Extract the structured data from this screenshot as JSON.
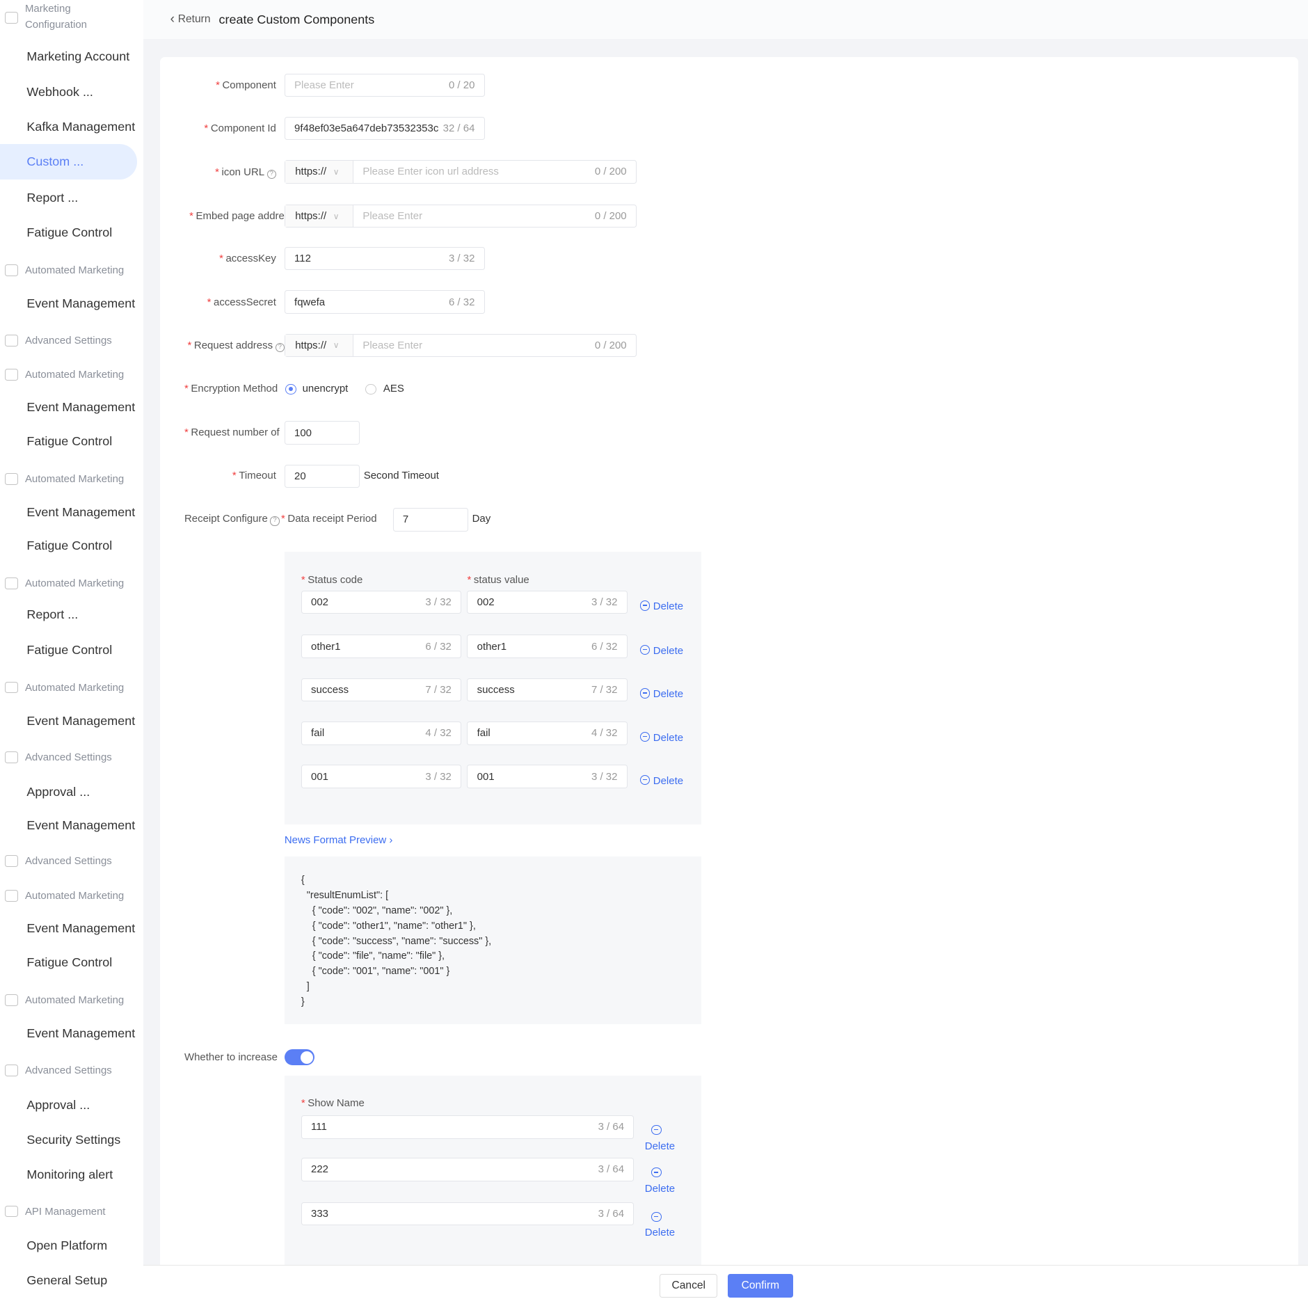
{
  "sidebar": {
    "items": [
      {
        "type": "group",
        "label": "Marketing Configuration"
      },
      {
        "type": "item",
        "label": "Marketing Account"
      },
      {
        "type": "item",
        "label": "Webhook ..."
      },
      {
        "type": "item",
        "label": "Kafka Management"
      },
      {
        "type": "item",
        "label": "Custom ...",
        "active": true
      },
      {
        "type": "item",
        "label": "Report ..."
      },
      {
        "type": "item",
        "label": "Fatigue Control"
      },
      {
        "type": "group",
        "label": "Automated Marketing"
      },
      {
        "type": "item",
        "label": "Event Management"
      },
      {
        "type": "group",
        "label": "Advanced Settings"
      },
      {
        "type": "group",
        "label": "Automated Marketing"
      },
      {
        "type": "item",
        "label": "Event Management"
      },
      {
        "type": "item",
        "label": "Fatigue Control"
      },
      {
        "type": "group",
        "label": "Automated Marketing"
      },
      {
        "type": "item",
        "label": "Event Management"
      },
      {
        "type": "item",
        "label": "Fatigue Control"
      },
      {
        "type": "group",
        "label": "Automated Marketing"
      },
      {
        "type": "item",
        "label": "Report ..."
      },
      {
        "type": "item",
        "label": "Fatigue Control"
      },
      {
        "type": "group",
        "label": "Automated Marketing"
      },
      {
        "type": "item",
        "label": "Event Management"
      },
      {
        "type": "group",
        "label": "Advanced Settings"
      },
      {
        "type": "item",
        "label": "Approval ..."
      },
      {
        "type": "item",
        "label": "Event Management"
      },
      {
        "type": "group",
        "label": "Advanced Settings"
      },
      {
        "type": "group",
        "label": "Automated Marketing"
      },
      {
        "type": "item",
        "label": "Event Management"
      },
      {
        "type": "item",
        "label": "Fatigue Control"
      },
      {
        "type": "group",
        "label": "Automated Marketing"
      },
      {
        "type": "item",
        "label": "Event Management"
      },
      {
        "type": "group",
        "label": "Advanced Settings"
      },
      {
        "type": "item",
        "label": "Approval ..."
      },
      {
        "type": "item",
        "label": "Security Settings"
      },
      {
        "type": "item",
        "label": "Monitoring alert"
      },
      {
        "type": "group",
        "label": "API Management"
      },
      {
        "type": "item",
        "label": "Open Platform"
      },
      {
        "type": "item",
        "label": "General Setup"
      }
    ]
  },
  "header": {
    "return_label": "Return",
    "title": "create Custom Components"
  },
  "form": {
    "component": {
      "label": "Component",
      "placeholder": "Please Enter",
      "count": "0 / 20"
    },
    "component_id": {
      "label": "Component Id",
      "value": "9f48ef03e5a647deb73532353c",
      "count": "32 / 64"
    },
    "icon_url": {
      "label": "icon URL",
      "protocol": "https://",
      "placeholder": "Please Enter icon url address",
      "count": "0 / 200"
    },
    "embed": {
      "label": "Embed page addre",
      "protocol": "https://",
      "placeholder": "Please Enter",
      "count": "0 / 200"
    },
    "access_key": {
      "label": "accessKey",
      "value": "112",
      "count": "3 / 32"
    },
    "access_secret": {
      "label": "accessSecret",
      "value": "fqwefa",
      "count": "6 / 32"
    },
    "request_address": {
      "label": "Request address",
      "protocol": "https://",
      "placeholder": "Please Enter",
      "count": "0 / 200"
    },
    "encryption": {
      "label": "Encryption Method",
      "options": [
        "unencrypt",
        "AES"
      ],
      "selected": "unencrypt"
    },
    "request_number": {
      "label": "Request number of",
      "value": "100"
    },
    "timeout": {
      "label": "Timeout",
      "value": "20",
      "suffix": "Second Timeout"
    },
    "receipt": {
      "label": "Receipt Configure",
      "period_label": "Data receipt Period",
      "value": "7",
      "suffix": "Day"
    },
    "status_headers": {
      "code": "Status code",
      "value": "status value"
    },
    "status_rows": [
      {
        "code": "002",
        "code_count": "3 / 32",
        "value": "002",
        "value_count": "3 / 32"
      },
      {
        "code": "other1",
        "code_count": "6 / 32",
        "value": "other1",
        "value_count": "6 / 32"
      },
      {
        "code": "success",
        "code_count": "7 / 32",
        "value": "success",
        "value_count": "7 / 32"
      },
      {
        "code": "fail",
        "code_count": "4 / 32",
        "value": "fail",
        "value_count": "4 / 32"
      },
      {
        "code": "001",
        "code_count": "3 / 32",
        "value": "001",
        "value_count": "3 / 32"
      }
    ],
    "delete_label": "Delete",
    "preview_link": "News Format Preview",
    "preview_code": "{\n  \"resultEnumList\": [\n    { \"code\": \"002\", \"name\": \"002\" },\n    { \"code\": \"other1\", \"name\": \"other1\" },\n    { \"code\": \"success\", \"name\": \"success\" },\n    { \"code\": \"file\", \"name\": \"file\" },\n    { \"code\": \"001\", \"name\": \"001\" }\n  ]\n}",
    "increase": {
      "label": "Whether to increase",
      "enabled": true
    },
    "show_name_label": "Show Name",
    "show_names": [
      {
        "value": "111",
        "count": "3 / 64"
      },
      {
        "value": "222",
        "count": "3 / 64"
      },
      {
        "value": "333",
        "count": "3 / 64"
      }
    ]
  },
  "footer": {
    "cancel": "Cancel",
    "confirm": "Confirm"
  },
  "colors": {
    "accent": "#5b7ff5",
    "link": "#3c6df0",
    "required": "#f04040"
  }
}
